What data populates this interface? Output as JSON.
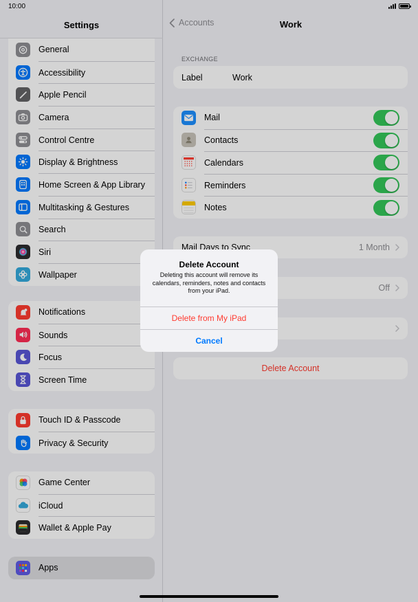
{
  "status_bar": {
    "time": "10:00"
  },
  "sidebar": {
    "title": "Settings",
    "groups": [
      [
        {
          "label": "General",
          "icon": "gear-icon",
          "color": "#8e8e93"
        },
        {
          "label": "Accessibility",
          "icon": "accessibility-icon",
          "color": "#007aff"
        },
        {
          "label": "Apple Pencil",
          "icon": "pencil-icon",
          "color": "#636366"
        },
        {
          "label": "Camera",
          "icon": "camera-icon",
          "color": "#8e8e93"
        },
        {
          "label": "Control Centre",
          "icon": "toggles-icon",
          "color": "#8e8e93"
        },
        {
          "label": "Display & Brightness",
          "icon": "sun-icon",
          "color": "#007aff"
        },
        {
          "label": "Home Screen & App Library",
          "icon": "home-screen-icon",
          "color": "#007aff"
        },
        {
          "label": "Multitasking & Gestures",
          "icon": "multitasking-icon",
          "color": "#007aff"
        },
        {
          "label": "Search",
          "icon": "search-icon",
          "color": "#8e8e93"
        },
        {
          "label": "Siri",
          "icon": "siri-icon",
          "color": "#2c2c2e"
        },
        {
          "label": "Wallpaper",
          "icon": "flower-icon",
          "color": "#34aadc"
        }
      ],
      [
        {
          "label": "Notifications",
          "icon": "bell-icon",
          "color": "#ff3b30"
        },
        {
          "label": "Sounds",
          "icon": "speaker-icon",
          "color": "#ff2d55"
        },
        {
          "label": "Focus",
          "icon": "moon-icon",
          "color": "#5856d6"
        },
        {
          "label": "Screen Time",
          "icon": "hourglass-icon",
          "color": "#5856d6"
        }
      ],
      [
        {
          "label": "Touch ID & Passcode",
          "icon": "lock-icon",
          "color": "#ff3b30"
        },
        {
          "label": "Privacy & Security",
          "icon": "hand-icon",
          "color": "#007aff"
        }
      ],
      [
        {
          "label": "Game Center",
          "icon": "game-center-icon",
          "color": "#ffffff"
        },
        {
          "label": "iCloud",
          "icon": "cloud-icon",
          "color": "#ffffff"
        },
        {
          "label": "Wallet & Apple Pay",
          "icon": "wallet-icon",
          "color": "#2c2c2e"
        }
      ],
      [
        {
          "label": "Apps",
          "icon": "apps-grid-icon",
          "color": "#5e5ce6",
          "selected": true
        }
      ]
    ]
  },
  "detail": {
    "back_label": "Accounts",
    "title": "Work",
    "section_caption": "EXCHANGE",
    "label_key": "Label",
    "label_value": "Work",
    "apps": [
      {
        "label": "Mail",
        "icon": "mail-icon",
        "on": true
      },
      {
        "label": "Contacts",
        "icon": "contacts-icon",
        "on": true
      },
      {
        "label": "Calendars",
        "icon": "calendar-icon",
        "on": true
      },
      {
        "label": "Reminders",
        "icon": "reminders-icon",
        "on": true
      },
      {
        "label": "Notes",
        "icon": "notes-icon",
        "on": true
      }
    ],
    "mail_days_label": "Mail Days to Sync",
    "mail_days_value": "1 Month",
    "off_value": "Off",
    "delete_account_label": "Delete Account"
  },
  "alert": {
    "title": "Delete Account",
    "message": "Deleting this account will remove its calendars, reminders, notes and contacts from your iPad.",
    "destructive_label": "Delete from My iPad",
    "cancel_label": "Cancel"
  },
  "colors": {
    "accent": "#007aff",
    "destructive": "#ff3b30",
    "toggle_on": "#34c759"
  }
}
